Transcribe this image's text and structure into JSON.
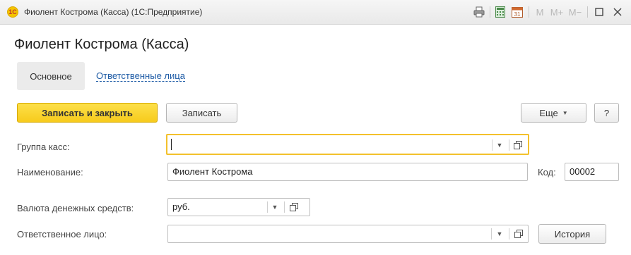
{
  "window": {
    "title": "Фиолент Кострома (Касса)  (1С:Предприятие)",
    "logo_text": "1С",
    "toolbar": {
      "m_label": "M",
      "m_plus_label": "M+",
      "m_minus_label": "M−",
      "calendar_day": "31"
    }
  },
  "form": {
    "title": "Фиолент Кострома (Касса)",
    "tabs": {
      "main": "Основное",
      "responsible": "Ответственные лица"
    },
    "buttons": {
      "save_close": "Записать и закрыть",
      "save": "Записать",
      "more": "Еще",
      "help": "?",
      "history": "История"
    },
    "fields": {
      "group_label": "Группа касс:",
      "group_value": "",
      "name_label": "Наименование:",
      "name_value": "Фиолент Кострома",
      "code_label": "Код:",
      "code_value": "00002",
      "currency_label": "Валюта денежных средств:",
      "currency_value": "руб.",
      "responsible_label": "Ответственное лицо:",
      "responsible_value": ""
    }
  },
  "colors": {
    "primary_button": "#f7cb1c",
    "focus_border": "#f3c12c",
    "link": "#1f5ca6"
  }
}
